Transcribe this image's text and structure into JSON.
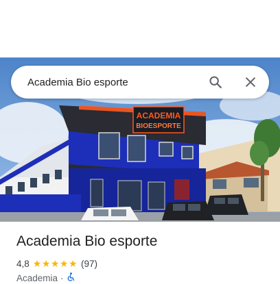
{
  "search": {
    "value": "Academia Bio esporte",
    "search_icon": "search-icon",
    "close_icon": "close-icon"
  },
  "photo": {
    "sign_line1": "ACADEMIA",
    "sign_line2": "BIOESPORTE"
  },
  "place": {
    "name": "Academia Bio esporte",
    "rating": "4,8",
    "stars": "★★★★★",
    "reviews": "(97)",
    "category": "Academia",
    "separator": "·",
    "accessibility_icon": "wheelchair-icon"
  },
  "colors": {
    "building_blue": "#1d2fb8",
    "sign_orange": "#ff5a1f",
    "star": "#f6b704",
    "accent": "#1a73e8"
  }
}
